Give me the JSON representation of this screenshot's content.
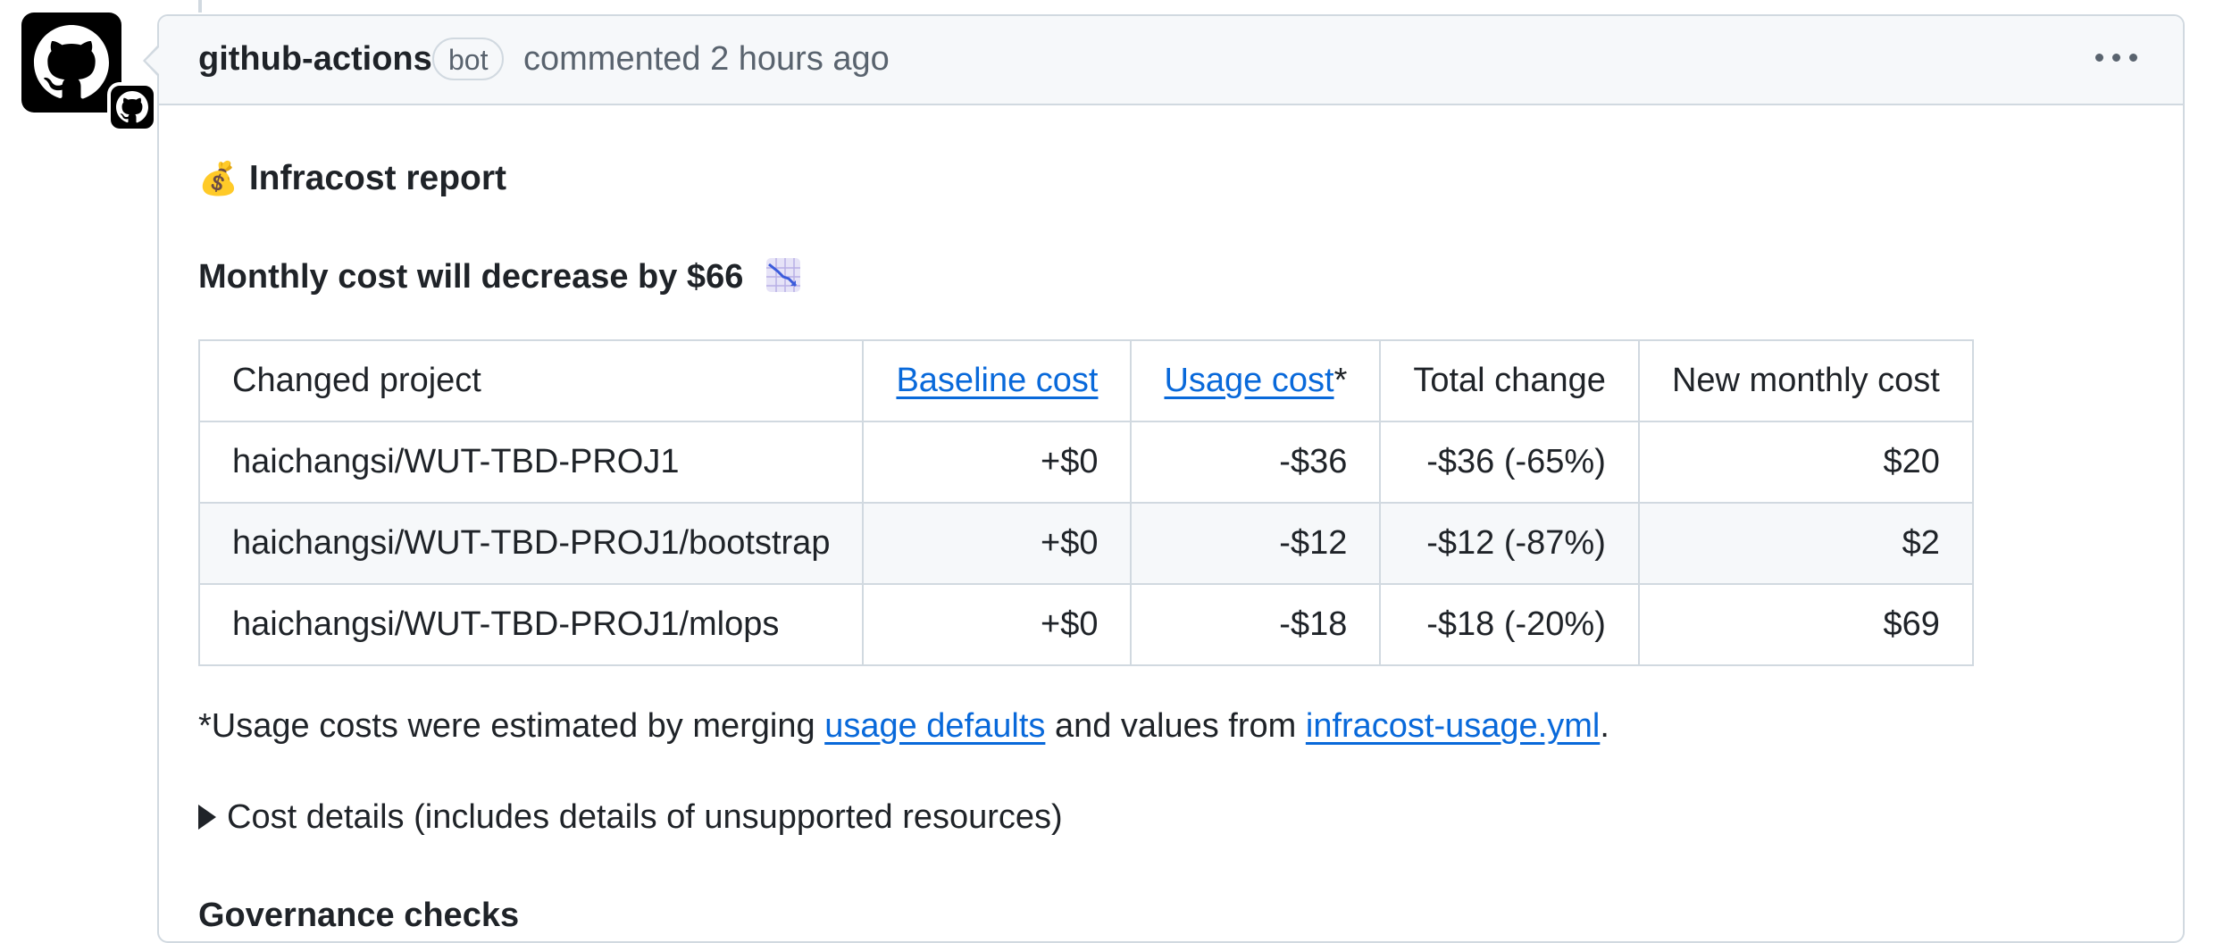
{
  "comment": {
    "author": "github-actions",
    "badge": "bot",
    "timestamp": "commented 2 hours ago",
    "menu_icon": "kebab-horizontal-icon"
  },
  "report": {
    "emoji": "💰",
    "title": "Infracost report",
    "summary": "Monthly cost will decrease by $66",
    "summary_icon": "chart-decreasing-icon"
  },
  "table": {
    "headers": [
      "Changed project",
      "Baseline cost",
      "Usage cost",
      "*",
      "Total change",
      "New monthly cost"
    ],
    "rows": [
      [
        "haichangsi/WUT-TBD-PROJ1",
        "+$0",
        "-$36",
        "-$36 (-65%)",
        "$20"
      ],
      [
        "haichangsi/WUT-TBD-PROJ1/bootstrap",
        "+$0",
        "-$12",
        "-$12 (-87%)",
        "$2"
      ],
      [
        "haichangsi/WUT-TBD-PROJ1/mlops",
        "+$0",
        "-$18",
        "-$18 (-20%)",
        "$69"
      ]
    ]
  },
  "note": {
    "prefix": "*Usage costs were estimated by merging ",
    "link1": "usage defaults",
    "middle": " and values from ",
    "link2": "infracost-usage.yml",
    "suffix": "."
  },
  "details": {
    "summary": "Cost details (includes details of unsupported resources)"
  },
  "governance": {
    "heading": "Governance checks"
  },
  "colors": {
    "link": "#0969da",
    "border": "#d1d9e0",
    "header_bg": "#f6f8fa",
    "muted": "#59636e"
  }
}
